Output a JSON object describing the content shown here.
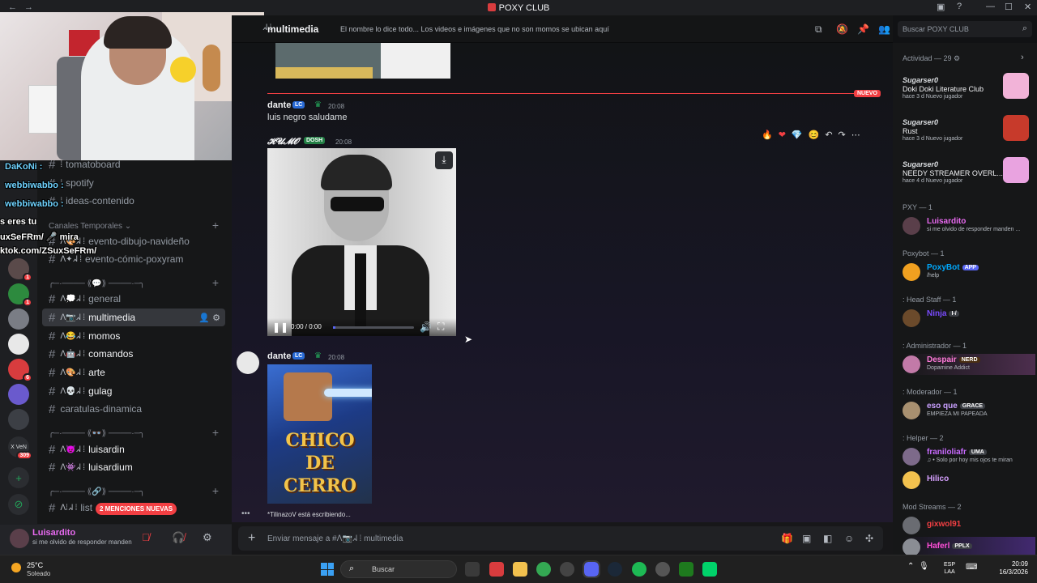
{
  "titlebar": {
    "title": "POXY CLUB",
    "back": "←",
    "forward": "→",
    "inbox_icon": "inbox-icon",
    "help": "?",
    "minimize": "—",
    "maximize": "☐",
    "close": "✕"
  },
  "guilds": {
    "badges": [
      "1",
      "1",
      "6",
      "309"
    ],
    "add_label": "+",
    "discover_label": "⊘"
  },
  "sidebar": {
    "top_channels": [
      {
        "label": "tomatoboard",
        "deco": "⁞"
      },
      {
        "label": "spotify",
        "deco": "⁞"
      },
      {
        "label": "ideas-contenido",
        "deco": "⁞"
      }
    ],
    "section_temporales": "Canales Temporales ⌄",
    "temp_channels": [
      {
        "label": "evento-dibujo-navideño",
        "deco": "ꓥ🎨ᖽ ⁞"
      },
      {
        "label": "evento-cómic-poxyram",
        "deco": "ꓥ✦ᖽ ⁞"
      }
    ],
    "section_2": "╭─·──── ⟪💬⟫ ────·─╮",
    "main_channels": [
      {
        "label": "general",
        "deco": "ꓥ💭ᖽ ⁞"
      },
      {
        "label": "multimedia",
        "deco": "ꓥ📷ᖽ ⁞"
      },
      {
        "label": "momos",
        "deco": "ꓥ😂ᖽ ⁞"
      },
      {
        "label": "comandos",
        "deco": "ꓥ🤖ᖽ ⁞"
      },
      {
        "label": "arte",
        "deco": "ꓥ🎨ᖽ ⁞"
      },
      {
        "label": "gulag",
        "deco": "ꓥ💀ᖽ ⁞"
      },
      {
        "label": "caratulas-dinamica",
        "deco": ""
      }
    ],
    "section_3": "╭─·──── ⟪👓⟫ ────·─╮",
    "extra_channels": [
      {
        "label": "luisardin",
        "deco": "ꓥ😈ᖽ ⁞"
      },
      {
        "label": "luisardium",
        "deco": "ꓥ👾ᖽ ⁞"
      }
    ],
    "section_4": "╭─·──── ⟪🔗⟫ ────·─╮",
    "last_channel": {
      "label": "list",
      "deco": "ꓥ⁞ᖽ ⁞"
    },
    "mentions_pill": "2 MENCIONES NUEVAS"
  },
  "user_panel": {
    "name": "Luisardito",
    "status": "si me olvido de responder manden o",
    "settings_icon": "gear-icon"
  },
  "overlay_chat": [
    {
      "name": "DaKoNi :",
      "text": "tomatoboard"
    },
    {
      "name": "webbiwabbo :",
      "text": ""
    },
    {
      "name": "webbiwabbo :",
      "text": ""
    },
    {
      "name": "",
      "text": "s eres tu"
    },
    {
      "name": "",
      "text": "uxSeFRm/ 🎤 mira"
    },
    {
      "name": "",
      "text": "ktok.com/ZSuxSeFRm/"
    }
  ],
  "header": {
    "channel_name": "multimedia",
    "channel_deco": "ᖽ ⁞",
    "topic": "El nombre lo dice todo... Los videos e imágenes que no son momos se ubican aquí",
    "search_placeholder": "Buscar POXY CLUB"
  },
  "messages": {
    "new_label": "NUEVO",
    "m1": {
      "author": "dante",
      "tag": "LC",
      "time": "20:08",
      "text": "luis negro saludame"
    },
    "m2": {
      "author": "𝓗𝓤𝓜𝓞",
      "tag": "DOSH",
      "time": "20:08",
      "video_time": "0:00 / 0:00",
      "video_progress": 0.03
    },
    "m3": {
      "author": "dante",
      "tag": "LC",
      "time": "20:08",
      "image_text": "CHICO DE CERRO"
    },
    "reactions": [
      "🔥",
      "❤",
      "💎",
      "😊",
      "↶",
      "↷",
      "⋯"
    ],
    "typing": "*TilinazoV está escribiendo..."
  },
  "composer": {
    "placeholder": "Enviar mensaje a #ꓥ📷ᖽ ⁞ multimedia",
    "plus": "+"
  },
  "members": {
    "activity_header": "Actividad — 29 ⚙",
    "activities": [
      {
        "user": "Sugarser0",
        "game": "Doki Doki Literature Club",
        "meta": "hace 3 d   Nuevo jugador",
        "art_color": "#f2b3d8"
      },
      {
        "user": "Sugarser0",
        "game": "Rust",
        "meta": "hace 3 d   Nuevo jugador",
        "art_color": "#c73a2b"
      },
      {
        "user": "Sugarser0",
        "game": "NEEDY STREAMER OVERL...",
        "meta": "hace 4 d   Nuevo jugador",
        "art_color": "#e9a3e0"
      }
    ],
    "sections": [
      {
        "title": "PXY — 1",
        "members": [
          {
            "name": "Luisardito",
            "sub": "si me olvido de responder manden ...",
            "color": "#e86af0",
            "tag": ""
          }
        ]
      },
      {
        "title": "Poxybot — 1",
        "members": [
          {
            "name": "PoxyBot",
            "sub": "/help",
            "color": "#00a8fc",
            "tag": "APP"
          }
        ]
      },
      {
        "title": ": Head Staff — 1",
        "members": [
          {
            "name": "Ninja",
            "sub": "",
            "color": "#7a4bff",
            "tag": "I-/"
          }
        ]
      },
      {
        "title": ": Administrador — 1",
        "members": [
          {
            "name": "Despair",
            "sub": "Dopamine Addict",
            "color": "#ff7ad9",
            "tag": "NERD"
          }
        ]
      },
      {
        "title": ": Moderador — 1",
        "members": [
          {
            "name": "eso que",
            "sub": "EMPIEZA MI PAPEADA",
            "color": "#c9a0ff",
            "tag": "GRACE"
          }
        ]
      },
      {
        "title": ": Helper — 2",
        "members": [
          {
            "name": "franiloliafr",
            "sub": "♫ • Solo por hoy mis ojos te miran",
            "color": "#c96bff",
            "tag": "UMA"
          },
          {
            "name": "Hilico",
            "sub": "",
            "color": "#d6a0ff",
            "tag": ""
          }
        ]
      },
      {
        "title": "Mod Streams — 2",
        "members": [
          {
            "name": "gixwol91",
            "sub": "",
            "color": "#f23f43",
            "tag": ""
          },
          {
            "name": "Haferl",
            "sub": "",
            "color": "#ff4fd8",
            "tag": "PPLX"
          }
        ]
      }
    ]
  },
  "taskbar": {
    "temp": "25°C",
    "weather": "Soleado",
    "search": "Buscar",
    "lang1": "ESP",
    "lang2": "LAA",
    "time": "20:09",
    "date": "16/3/2026"
  },
  "colors": {
    "accent": "#5865f2",
    "danger": "#f23f43",
    "bg": "#111214"
  }
}
